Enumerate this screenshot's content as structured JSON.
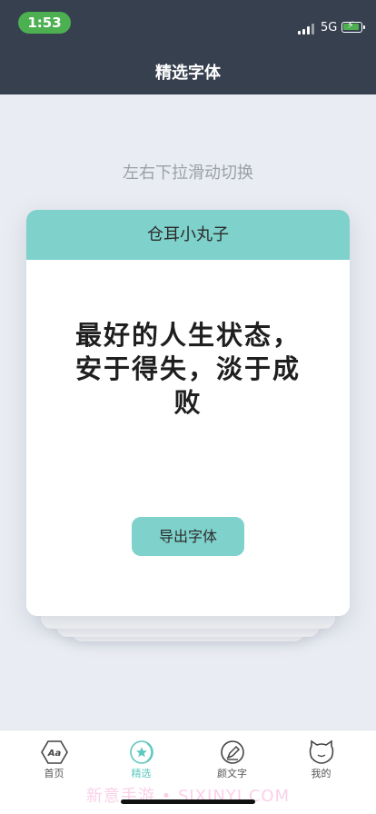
{
  "status_bar": {
    "time": "1:53",
    "network": "5G"
  },
  "header": {
    "title": "精选字体"
  },
  "hint": "左右下拉滑动切换",
  "card": {
    "font_name": "仓耳小丸子",
    "quote": "最好的人生状态，安于得失，淡于成败",
    "export_label": "导出字体"
  },
  "tabs": [
    {
      "label": "首页",
      "icon": "font-aa-icon"
    },
    {
      "label": "精选",
      "icon": "star-icon"
    },
    {
      "label": "颜文字",
      "icon": "pen-icon"
    },
    {
      "label": "我的",
      "icon": "cat-face-icon"
    }
  ],
  "watermark": "新意手游 • SIXINYI.COM",
  "colors": {
    "header_bg": "#36404f",
    "accent": "#7fd1cb",
    "active_tab": "#5cc8bf",
    "time_pill": "#4caf50"
  }
}
